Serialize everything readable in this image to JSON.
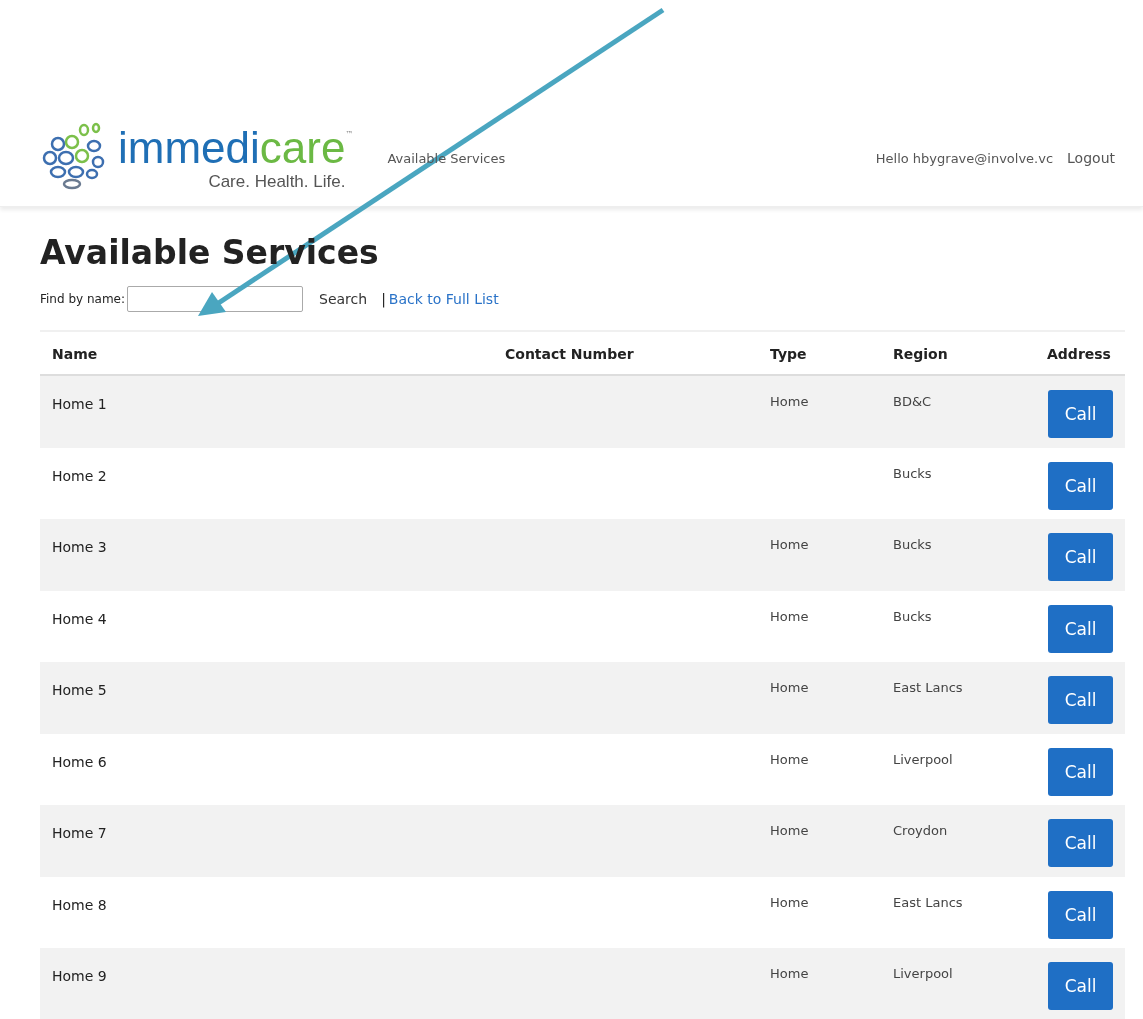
{
  "header": {
    "logo": {
      "brand": [
        "immedi",
        "care"
      ],
      "trademark": "™",
      "tagline": "Care. Health. Life."
    },
    "nav_link": "Available Services",
    "greeting": "Hello hbygrave@involve.vc",
    "logout": "Logout"
  },
  "page": {
    "title": "Available Services",
    "search": {
      "label": "Find by name:",
      "button": "Search",
      "separator": "|",
      "back_link": "Back to Full List"
    }
  },
  "table": {
    "columns": [
      "Name",
      "Contact Number",
      "Type",
      "Region",
      "Address"
    ],
    "rows": [
      {
        "name": "Home 1",
        "type": "Home",
        "region": "BD&C",
        "action": "Call"
      },
      {
        "name": "Home 2",
        "region": "Bucks",
        "action": "Call"
      },
      {
        "name": "Home 3",
        "type": "Home",
        "region": "Bucks",
        "action": "Call"
      },
      {
        "name": "Home 4",
        "type": "Home",
        "region": "Bucks",
        "action": "Call"
      },
      {
        "name": "Home 5",
        "type": "Home",
        "region": "East Lancs",
        "action": "Call"
      },
      {
        "name": "Home 6",
        "type": "Home",
        "region": "Liverpool",
        "action": "Call"
      },
      {
        "name": "Home 7",
        "type": "Home",
        "region": "Croydon",
        "action": "Call"
      },
      {
        "name": "Home 8",
        "type": "Home",
        "region": "East Lancs",
        "action": "Call"
      },
      {
        "name": "Home 9",
        "type": "Home",
        "region": "Liverpool",
        "action": "Call"
      }
    ]
  },
  "annotation": {
    "kind": "arrow"
  }
}
